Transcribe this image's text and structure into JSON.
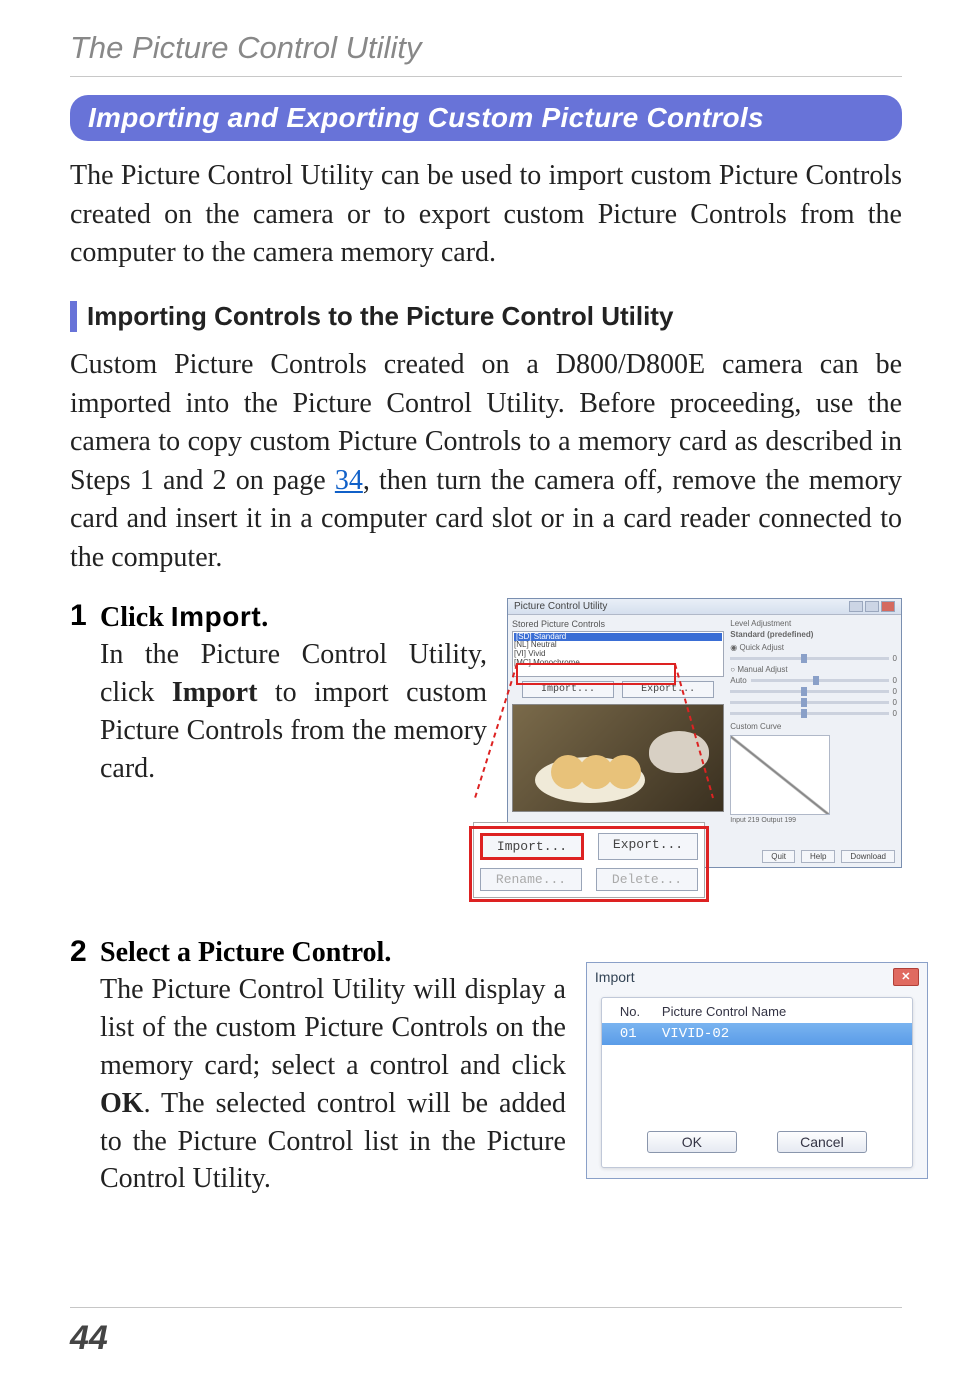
{
  "header": {
    "section_title": "The Picture Control Utility"
  },
  "section_heading": "Importing and Exporting Custom Picture Controls",
  "intro_paragraph": "The Picture Control Utility can be used to import custom Picture Controls created on the camera or to export custom Picture Controls from the computer to the camera memory card.",
  "subsection_heading": "Importing Controls to the Picture Control Utility",
  "body_paragraph_pre_link": "Custom Picture Controls created on a D800/D800E camera can be imported into the Picture Control Utility. Before proceeding, use the camera to copy custom Picture Controls to a memory card as described in Steps 1 and 2 on page ",
  "page_link_text": "34",
  "body_paragraph_post_link": ", then turn the camera off, remove the memory card and insert it in a computer card slot or in a card reader connected to the computer.",
  "step1": {
    "number": "1",
    "title_prefix": "Click ",
    "title_emphasis": "Import",
    "title_suffix": ".",
    "body_pre": "In the Picture Control Utility, click ",
    "body_emphasis": "Import",
    "body_post": " to import custom Picture Controls from the memory card."
  },
  "step2": {
    "number": "2",
    "title": "Select a Picture Control.",
    "body_pre": "The Picture Control Utility will display a list of the custom Picture Controls on the memory card; select a control and click ",
    "body_emphasis": "OK",
    "body_post": ". The selected control will be added to the Picture Control list in the Picture Control Utility."
  },
  "pc_utility_screenshot": {
    "window_title": "Picture Control Utility",
    "list_label": "Stored Picture Controls",
    "list_items": {
      "sel": "[SD] Standard",
      "i1": "[NL] Neutral",
      "i2": "[VI] Vivid",
      "i3": "[MC] Monochrome"
    },
    "buttons": {
      "import": "Import...",
      "export": "Export...",
      "rename": "Rename...",
      "delete": "Delete..."
    },
    "right_panel": {
      "heading1": "Level Adjustment",
      "heading2": "Standard (predefined)",
      "radio1": "Quick Adjust",
      "radio2": "Manual Adjust",
      "auto": "Auto",
      "curve_label": "Custom Curve",
      "output_label": "Input 219  Output 199"
    },
    "footer": {
      "b1": "Quit",
      "b2": "Help",
      "b3": "Download"
    }
  },
  "import_dialog": {
    "title": "Import",
    "close_glyph": "✕",
    "col_no": "No.",
    "col_name": "Picture Control Name",
    "row1_no": "01",
    "row1_name": "VIVID-02",
    "ok": "OK",
    "cancel": "Cancel"
  },
  "page_number": "44"
}
